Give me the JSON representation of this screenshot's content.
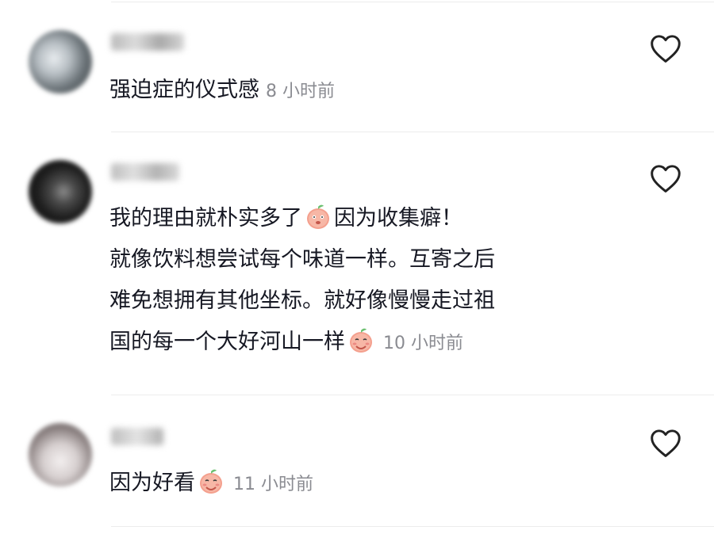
{
  "comments": [
    {
      "username": "",
      "lines": [
        "强迫症的仪式感"
      ],
      "time": "8 小时前",
      "emoji": null
    },
    {
      "username": "",
      "lines": [
        "我的理由就朴实多了",
        "因为收集癖！",
        "就像饮料想尝试每个味道一样。互寄之后",
        "难免想拥有其他坐标。就好像慢慢走过祖",
        "国的每一个大好河山一样"
      ],
      "time": "10 小时前",
      "emoji": "peach-emoji"
    },
    {
      "username": "",
      "lines": [
        "因为好看"
      ],
      "time": "11 小时前",
      "emoji": "peach-emoji"
    }
  ],
  "icons": {
    "like": "heart-outline-icon",
    "emoji": "peach-emoji-icon"
  },
  "colors": {
    "text": "#161823",
    "time": "#8a8b91",
    "divider": "#ececec",
    "heart_stroke": "#222222"
  }
}
